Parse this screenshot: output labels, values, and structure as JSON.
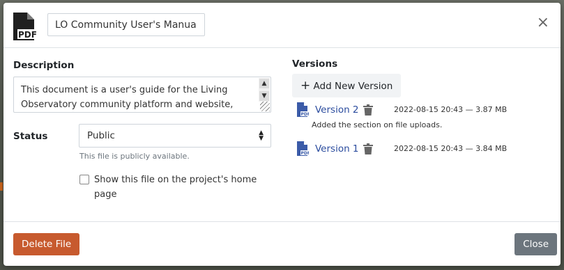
{
  "header": {
    "file_icon": "pdf-file-icon",
    "title_value": "LO Community User's Manual",
    "close_symbol": "×"
  },
  "description": {
    "label": "Description",
    "text": "This document is a user's guide for the Living Observatory community platform and website, with"
  },
  "status": {
    "label": "Status",
    "selected": "Public",
    "help": "This file is publicly available.",
    "home_checkbox_label": "Show this file on the project's home page",
    "home_checked": false
  },
  "versions": {
    "title": "Versions",
    "add_label": "Add New Version",
    "add_symbol": "+",
    "items": [
      {
        "name": "Version 2",
        "meta": "2022-08-15 20:43 — 3.87 MB",
        "note": "Added the section on file uploads."
      },
      {
        "name": "Version 1",
        "meta": "2022-08-15 20:43 — 3.84 MB",
        "note": ""
      }
    ]
  },
  "footer": {
    "delete_label": "Delete File",
    "close_label": "Close"
  },
  "colors": {
    "delete_button": "#c75a2e",
    "close_button": "#6c757d",
    "link": "#2b4c9e",
    "pdf_icon": "#3b5ba8"
  }
}
